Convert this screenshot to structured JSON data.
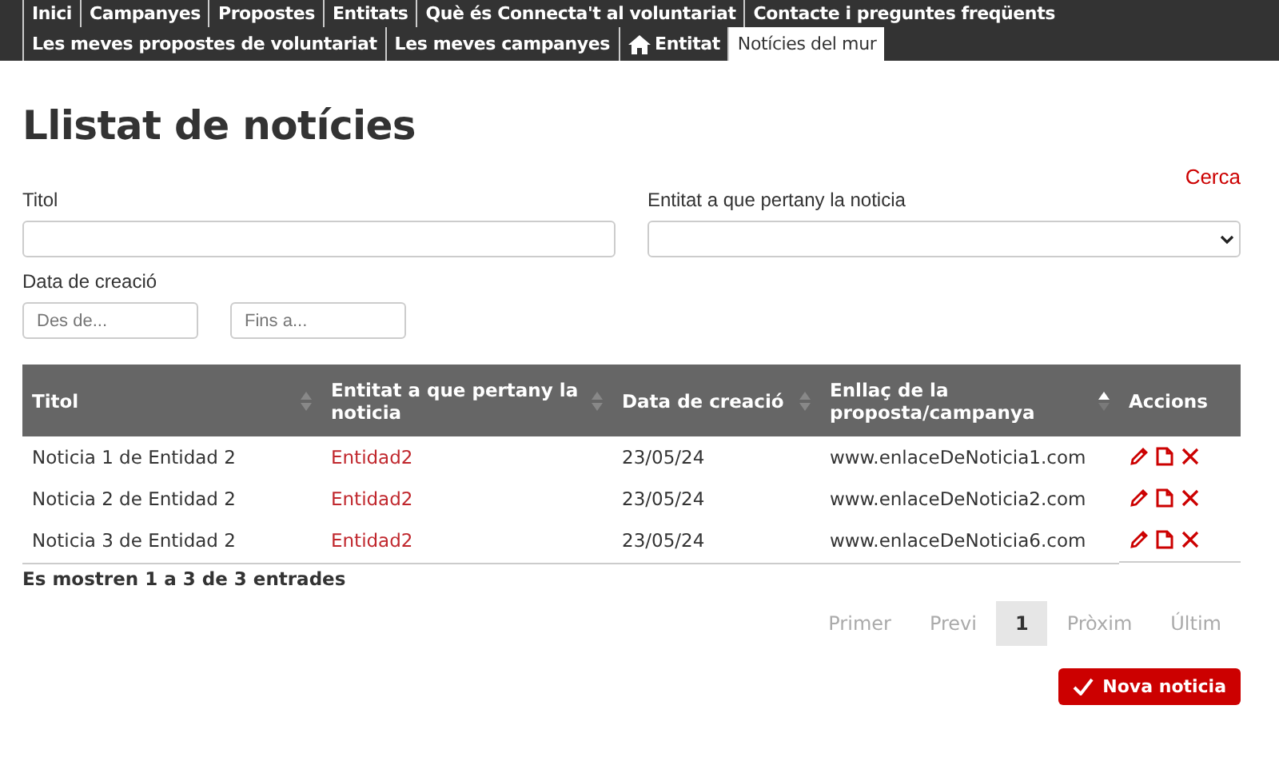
{
  "nav_main": [
    {
      "label": "Inici",
      "selected": false
    },
    {
      "label": "Campanyes",
      "selected": false
    },
    {
      "label": "Propostes",
      "selected": false
    },
    {
      "label": "Entitats",
      "selected": false
    },
    {
      "label": "Què és Connecta't al voluntariat",
      "selected": false
    },
    {
      "label": "Contacte i preguntes freqüents",
      "selected": false
    }
  ],
  "nav_user": [
    {
      "label": "Les meves propostes de voluntariat",
      "kind": "text",
      "selected": false
    },
    {
      "label": "Les meves campanyes",
      "kind": "text",
      "selected": false
    },
    {
      "label": "Entitat",
      "kind": "home",
      "selected": false
    },
    {
      "label": "Notícies del mur",
      "kind": "text",
      "selected": true
    }
  ],
  "page_title": "Llistat de notícies",
  "search_link": "Cerca",
  "filters": {
    "title_label": "Titol",
    "entity_label": "Entitat a que pertany la noticia",
    "date_label": "Data de creació",
    "from_placeholder": "Des de...",
    "to_placeholder": "Fins a..."
  },
  "table": {
    "columns": [
      {
        "label": "Titol",
        "sortable": true,
        "sorted": false
      },
      {
        "label": "Entitat a que pertany la noticia",
        "sortable": true,
        "sorted": false
      },
      {
        "label": "Data de creació",
        "sortable": true,
        "sorted": false
      },
      {
        "label": "Enllaç de la proposta/campanya",
        "sortable": true,
        "sorted": true
      },
      {
        "label": "Accions",
        "sortable": false
      }
    ],
    "rows": [
      {
        "title": "Noticia 1 de Entidad 2",
        "entity": "Entidad2",
        "date": "23/05/24",
        "link": "www.enlaceDeNoticia1.com"
      },
      {
        "title": "Noticia 2 de Entidad 2",
        "entity": "Entidad2",
        "date": "23/05/24",
        "link": "www.enlaceDeNoticia2.com"
      },
      {
        "title": "Noticia 3 de Entidad 2",
        "entity": "Entidad2",
        "date": "23/05/24",
        "link": "www.enlaceDeNoticia6.com"
      }
    ]
  },
  "table_info": "Es mostren 1 a 3 de 3 entrades",
  "pagination": [
    {
      "label": "Primer",
      "selected": false
    },
    {
      "label": "Previ",
      "selected": false
    },
    {
      "label": "1",
      "selected": true
    },
    {
      "label": "Pròxim",
      "selected": false
    },
    {
      "label": "Últim",
      "selected": false
    }
  ],
  "new_button": "Nova noticia"
}
